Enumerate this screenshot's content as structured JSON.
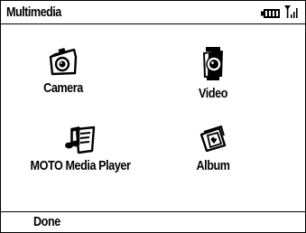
{
  "title_bar": {
    "title": "Multimedia",
    "battery_icon": "battery-icon",
    "signal_icon": "signal-strength-icon"
  },
  "menu": {
    "items": [
      {
        "label": "Camera",
        "icon": "camera-icon"
      },
      {
        "label": "Video",
        "icon": "video-camera-icon"
      },
      {
        "label": "MOTO Media Player",
        "icon": "media-player-icon"
      },
      {
        "label": "Album",
        "icon": "album-icon"
      }
    ]
  },
  "softkeys": {
    "left": "Done"
  }
}
